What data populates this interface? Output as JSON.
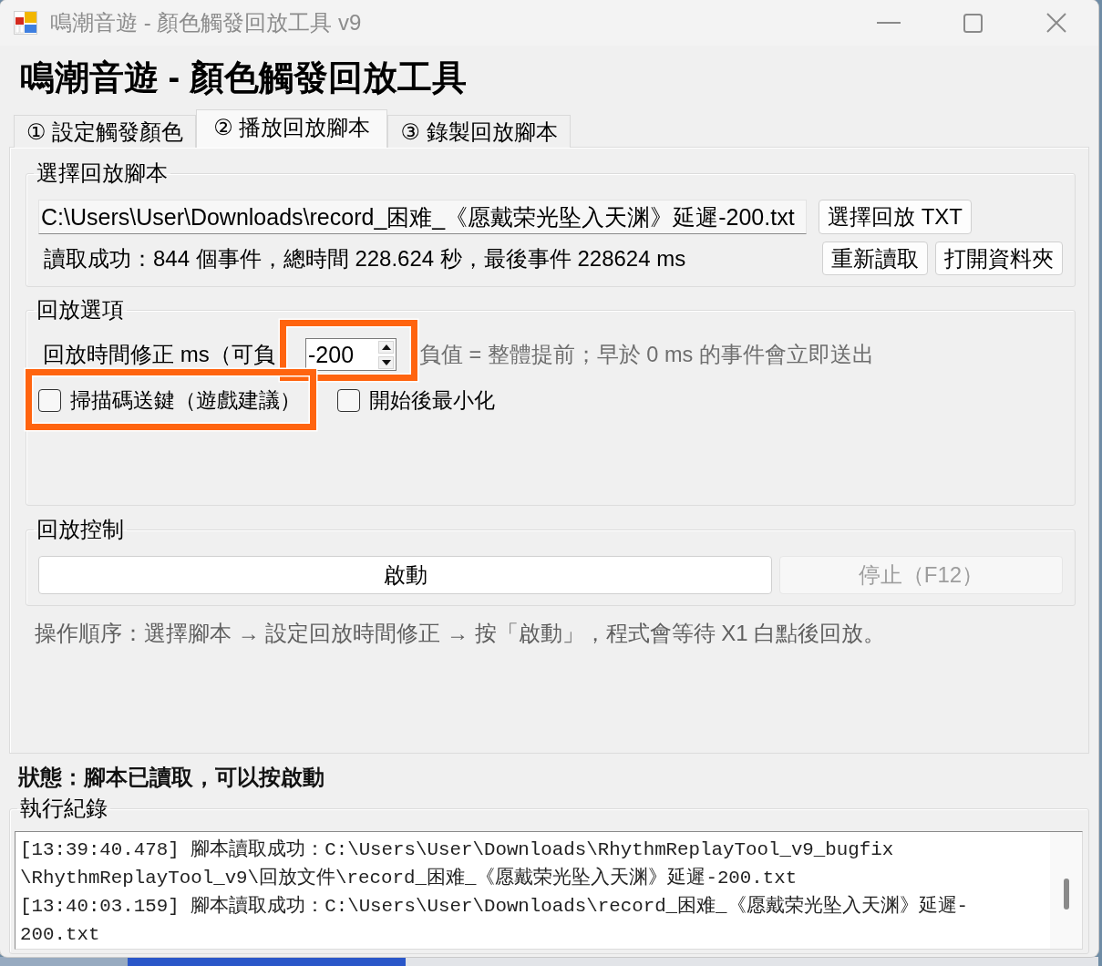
{
  "window": {
    "title": "鳴潮音遊 - 顏色觸發回放工具 v9"
  },
  "heading": "鳴潮音遊 - 顏色觸發回放工具",
  "tabs": [
    {
      "label": "① 設定觸發顏色",
      "selected": false
    },
    {
      "label": "② 播放回放腳本",
      "selected": true
    },
    {
      "label": "③ 錄製回放腳本",
      "selected": false
    }
  ],
  "script_group": {
    "title": "選擇回放腳本",
    "path": "C:\\Users\\User\\Downloads\\record_困难_《愿戴荣光坠入天渊》延遲-200.txt",
    "browse_button": "選擇回放 TXT",
    "load_info": "讀取成功：844 個事件，總時間 228.624 秒，最後事件 228624 ms",
    "buttons": [
      "重新讀取",
      "打開資料夾"
    ]
  },
  "options_group": {
    "title": "回放選項",
    "offset": {
      "label": "回放時間修正 ms（可負",
      "value": "-200",
      "highlighted": true
    },
    "hint": "負值 = 整體提前；早於 0 ms 的事件會立即送出",
    "checkboxes": [
      {
        "label": "掃描碼送鍵（遊戲建議）",
        "checked": false,
        "highlighted": true
      },
      {
        "label": "開始後最小化",
        "checked": false,
        "highlighted": false
      }
    ]
  },
  "control_group": {
    "title": "回放控制",
    "buttons": [
      {
        "label": "啟動",
        "disabled": false
      },
      {
        "label": "停止（F12）",
        "disabled": true
      }
    ]
  },
  "instructions": "操作順序：選擇腳本 → 設定回放時間修正 → 按「啟動」，程式會等待 X1 白點後回放。",
  "status": "狀態：腳本已讀取，可以按啟動",
  "log": {
    "title": "執行紀錄",
    "lines": [
      "[13:39:40.478] 腳本讀取成功：C:\\Users\\User\\Downloads\\RhythmReplayTool_v9_bugfix",
      "\\RhythmReplayTool_v9\\回放文件\\record_困难_《愿戴荣光坠入天渊》延遲-200.txt",
      "[13:40:03.159] 腳本讀取成功：C:\\Users\\User\\Downloads\\record_困难_《愿戴荣光坠入天渊》延遲-",
      "200.txt"
    ]
  }
}
